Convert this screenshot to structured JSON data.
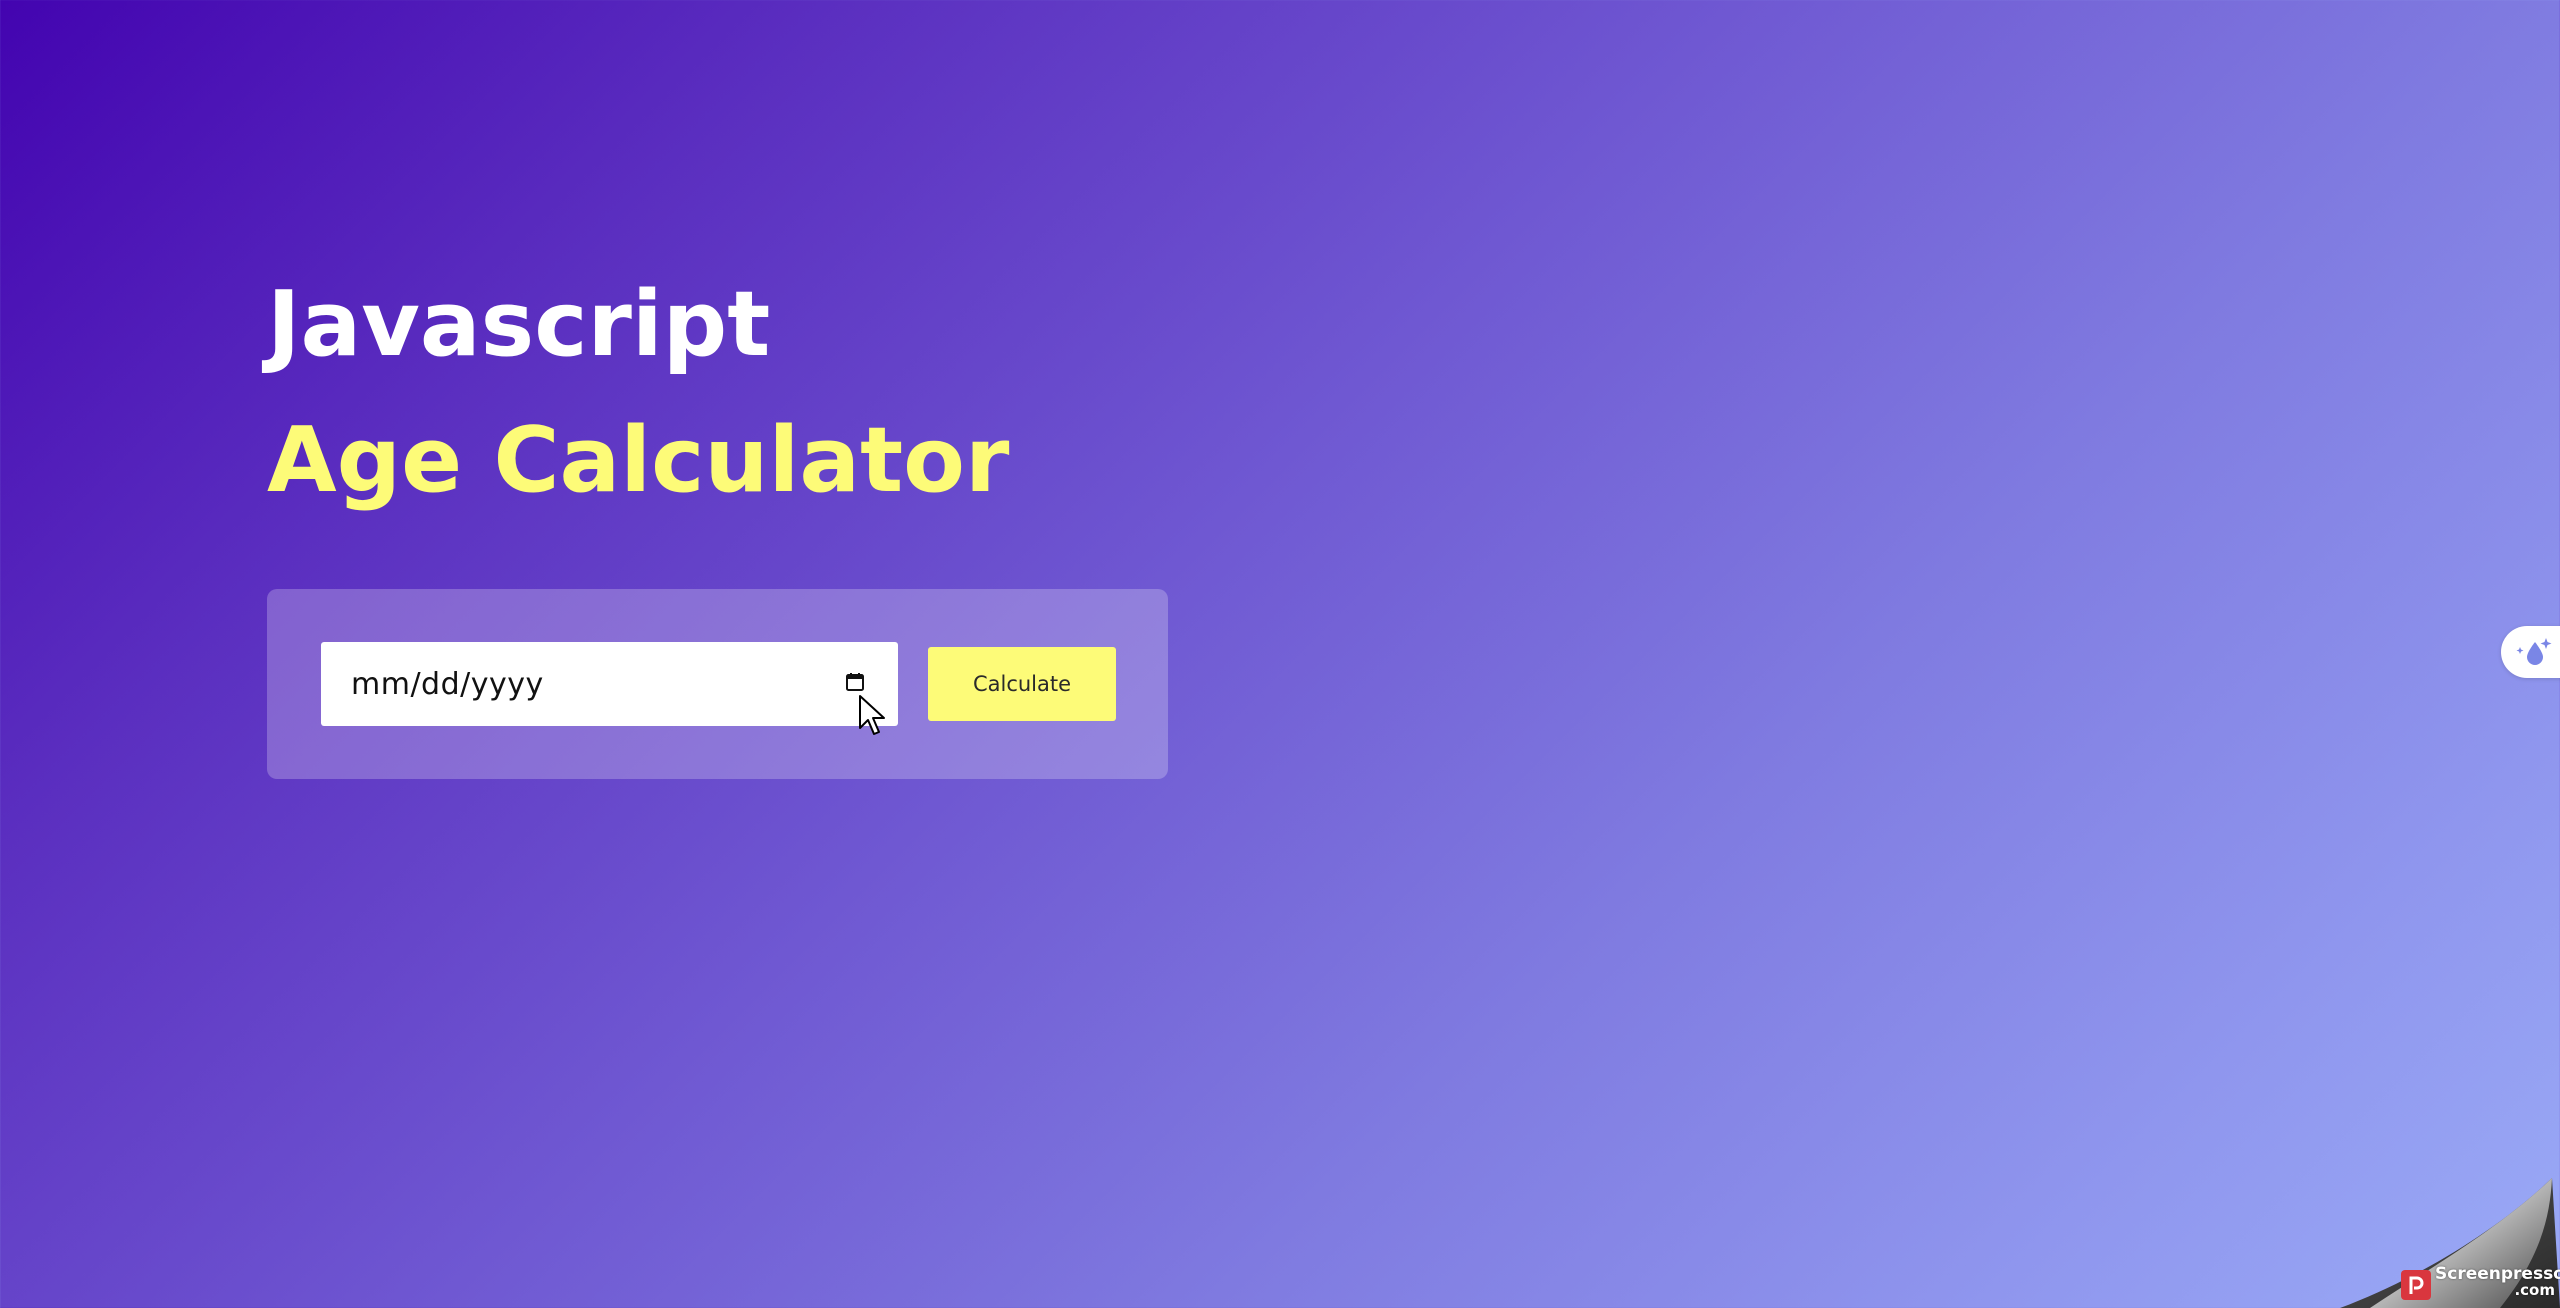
{
  "heading": {
    "line1": "Javascript",
    "line2": "Age Calculator"
  },
  "form": {
    "date_placeholder": "mm/dd/yyyy",
    "button_label": "Calculate"
  },
  "colors": {
    "accent_yellow": "#fdfb78",
    "gradient_start": "#4304b0",
    "gradient_end": "#9aaaf6"
  },
  "icons": {
    "calendar": "calendar-icon",
    "cursor": "mouse-cursor-icon",
    "side_widget": "sparkle-drop-icon"
  },
  "watermark": {
    "brand": "Screenpresso",
    "domain": ".com"
  }
}
